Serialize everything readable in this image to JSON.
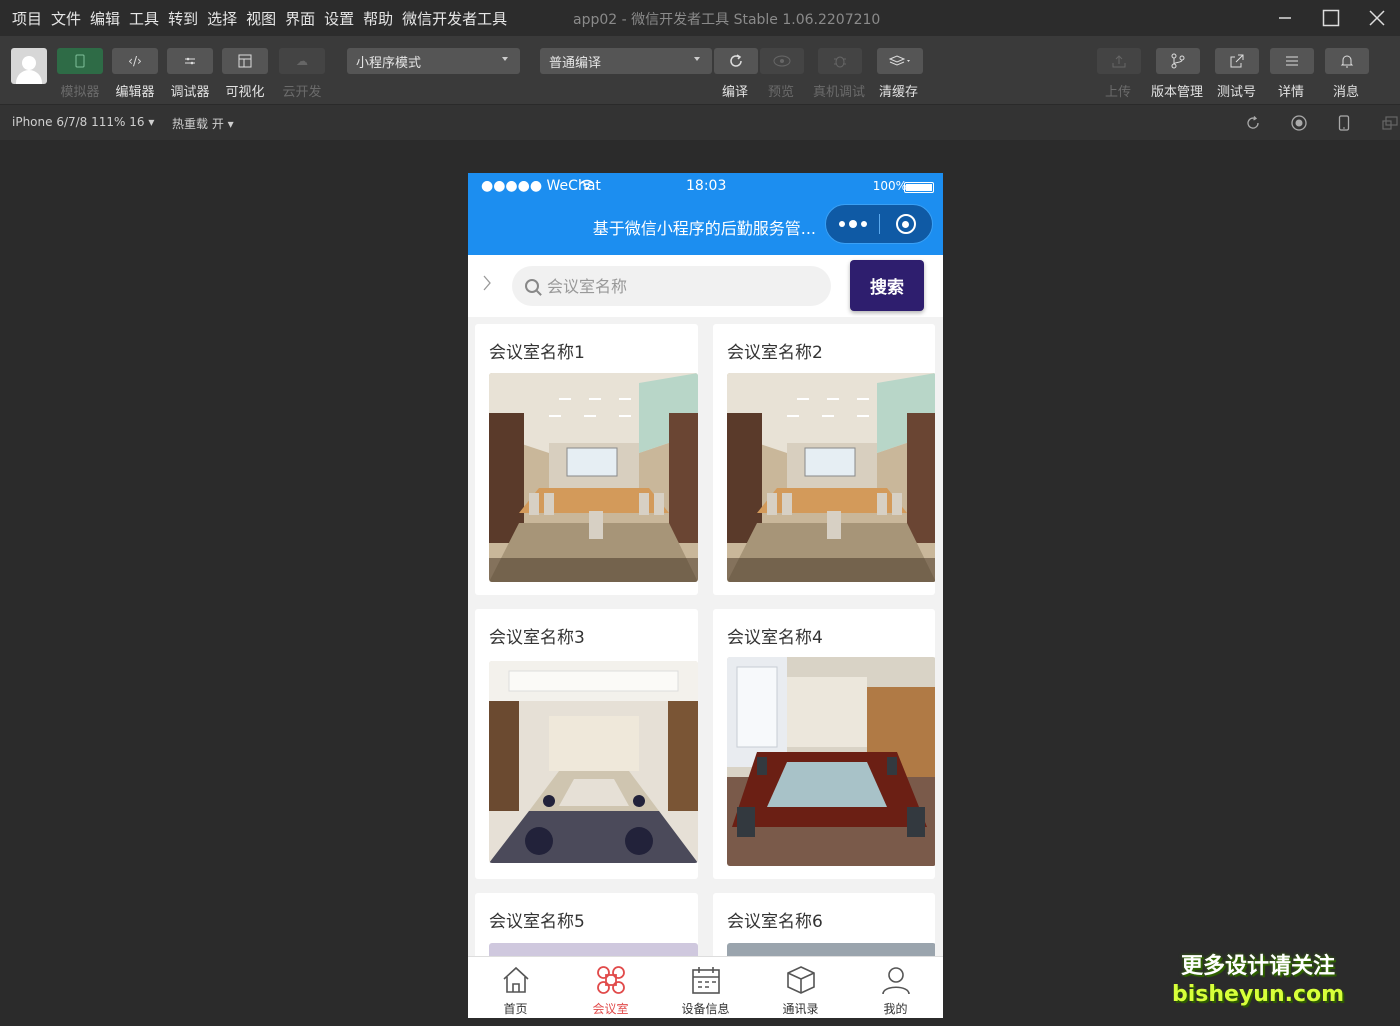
{
  "menubar": {
    "items": [
      "项目",
      "文件",
      "编辑",
      "工具",
      "转到",
      "选择",
      "视图",
      "界面",
      "设置",
      "帮助",
      "微信开发者工具"
    ],
    "title": "app02 - 微信开发者工具 Stable 1.06.2207210"
  },
  "toolbar": {
    "simulator": "模拟器",
    "editor": "编辑器",
    "debugger": "调试器",
    "visual": "可视化",
    "cloud": "云开发",
    "mode_select": "小程序模式",
    "compile_select": "普通编译",
    "compile": "编译",
    "preview": "预览",
    "real_debug": "真机调试",
    "clear_cache": "清缓存",
    "upload": "上传",
    "version": "版本管理",
    "test_id": "测试号",
    "details": "详情",
    "messages": "消息"
  },
  "subbar": {
    "device": "iPhone 6/7/8 111% 16 ▾",
    "hotreload": "热重载 开 ▾"
  },
  "phone": {
    "status": {
      "carrier": "●●●●● WeChat",
      "time": "18:03",
      "battery": "100%"
    },
    "nav_title": "基于微信小程序的后勤服务管...",
    "search": {
      "placeholder": "会议室名称",
      "button": "搜索"
    },
    "cards": [
      {
        "title": "会议室名称1"
      },
      {
        "title": "会议室名称2"
      },
      {
        "title": "会议室名称3"
      },
      {
        "title": "会议室名称4"
      },
      {
        "title": "会议室名称5"
      },
      {
        "title": "会议室名称6"
      }
    ],
    "tabs": [
      {
        "label": "首页",
        "icon": "home-icon"
      },
      {
        "label": "会议室",
        "icon": "grid-icon"
      },
      {
        "label": "设备信息",
        "icon": "calendar-icon"
      },
      {
        "label": "通讯录",
        "icon": "box-icon"
      },
      {
        "label": "我的",
        "icon": "user-icon"
      }
    ]
  },
  "watermark": {
    "line1": "更多设计请关注",
    "line2": "bisheyun.com"
  },
  "colors": {
    "nav_blue": "#1c8ef0",
    "search_button": "#2e1e6e",
    "active_tab": "#e14b4b"
  }
}
